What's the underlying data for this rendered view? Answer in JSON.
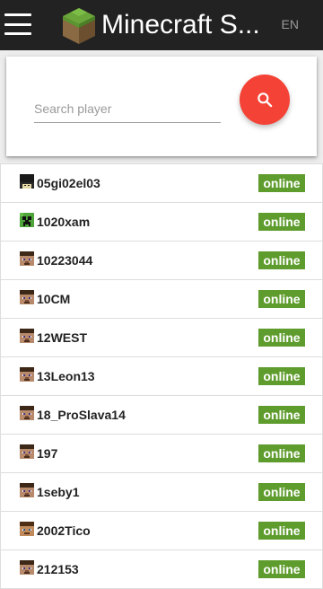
{
  "app_bar": {
    "title": "Minecraft S...",
    "language": "EN",
    "menu_icon": "hamburger-menu-icon",
    "logo_icon": "grass-block-logo"
  },
  "search": {
    "placeholder": "Search player",
    "value": "",
    "button_icon": "search-icon"
  },
  "colors": {
    "app_bar": "#222222",
    "search_fab": "#f44336",
    "online_badge": "#5f9c2e"
  },
  "players": [
    {
      "name": "05gi02el03",
      "status": "online",
      "avatar": "skin-dark"
    },
    {
      "name": "1020xam",
      "status": "online",
      "avatar": "skin-creeper"
    },
    {
      "name": "10223044",
      "status": "online",
      "avatar": "skin-steve"
    },
    {
      "name": "10CM",
      "status": "online",
      "avatar": "skin-steve"
    },
    {
      "name": "12WEST",
      "status": "online",
      "avatar": "skin-steve"
    },
    {
      "name": "13Leon13",
      "status": "online",
      "avatar": "skin-steve"
    },
    {
      "name": "18_ProSlava14",
      "status": "online",
      "avatar": "skin-steve"
    },
    {
      "name": "197",
      "status": "online",
      "avatar": "skin-steve"
    },
    {
      "name": "1seby1",
      "status": "online",
      "avatar": "skin-steve"
    },
    {
      "name": "2002Tico",
      "status": "online",
      "avatar": "skin-brown"
    },
    {
      "name": "212153",
      "status": "online",
      "avatar": "skin-steve"
    }
  ]
}
